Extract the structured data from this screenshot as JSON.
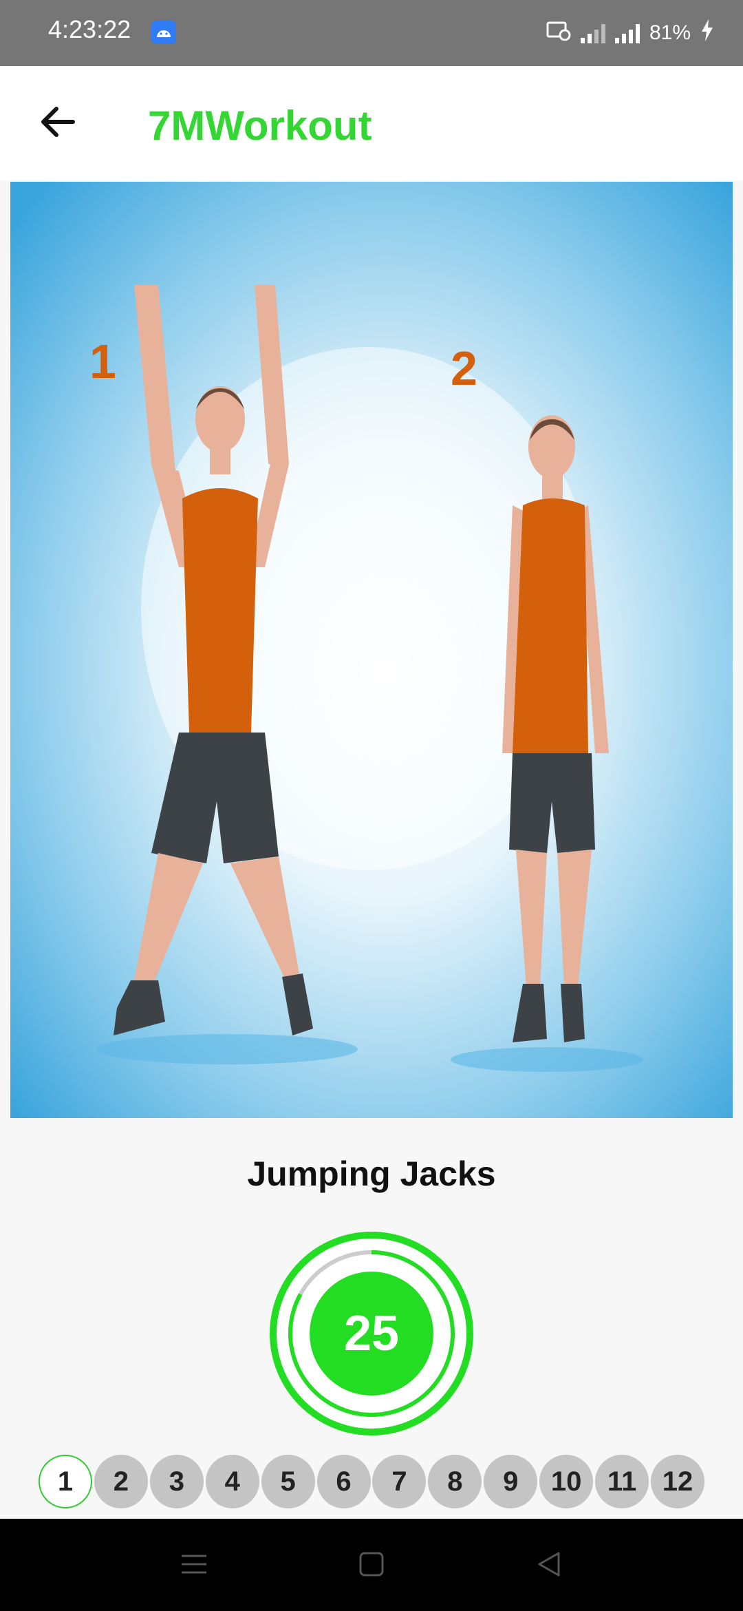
{
  "status_bar": {
    "time": "4:23:22",
    "battery": "81%",
    "icons": [
      "android-icon",
      "screen-record-icon",
      "signal-icon",
      "signal-icon",
      "charging-icon"
    ]
  },
  "app_bar": {
    "title": "7MWorkout",
    "back_icon": "arrow-left-icon",
    "title_color": "#33d633"
  },
  "exercise": {
    "name": "Jumping Jacks",
    "image_labels": [
      "1",
      "2"
    ]
  },
  "timer": {
    "value": "25",
    "accent": "#22dd22",
    "progress_fraction": 0.83
  },
  "steps": {
    "items": [
      "1",
      "2",
      "3",
      "4",
      "5",
      "6",
      "7",
      "8",
      "9",
      "10",
      "11",
      "12"
    ],
    "active_index": 0
  },
  "nav_bar": {
    "icons": [
      "menu-icon",
      "home-icon",
      "back-triangle-icon"
    ]
  }
}
